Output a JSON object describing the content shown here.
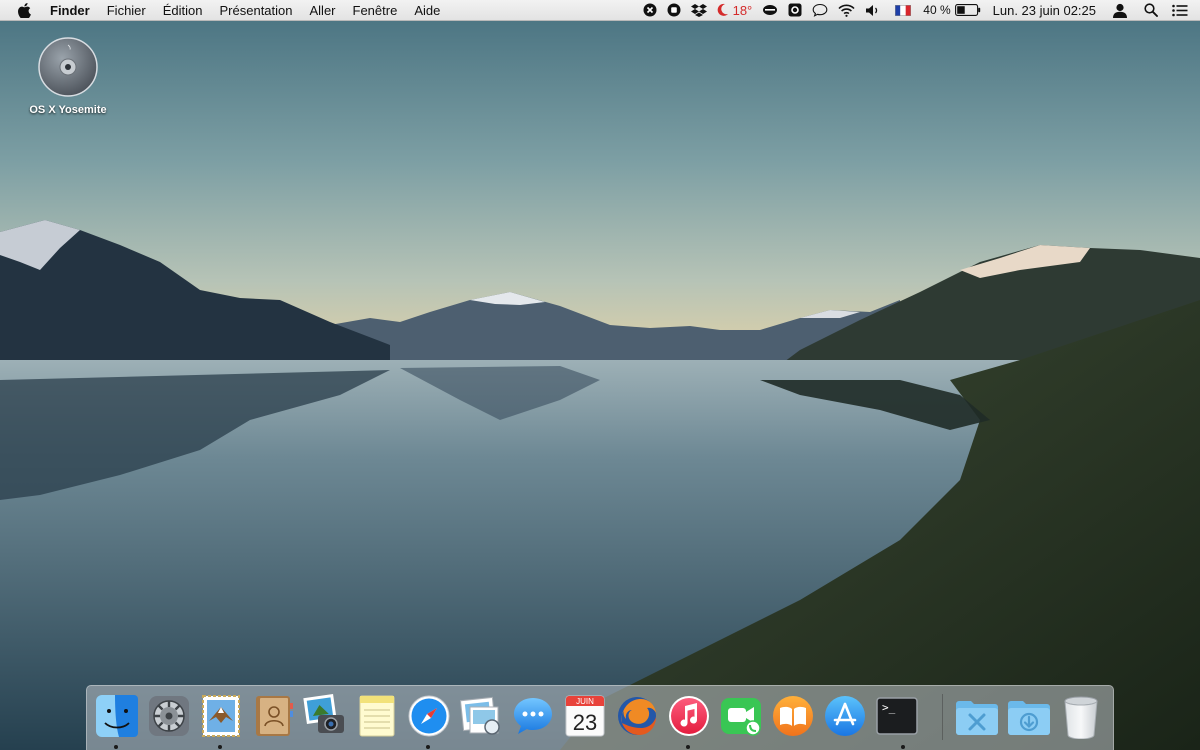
{
  "menubar": {
    "app_name": "Finder",
    "menus": [
      "Fichier",
      "Édition",
      "Présentation",
      "Aller",
      "Fenêtre",
      "Aide"
    ],
    "status": {
      "temperature": "18°",
      "battery_percent": "40 %",
      "clock": "Lun. 23 juin  02:25",
      "input_source": "fr-flag-icon",
      "battery_level": 0.4
    }
  },
  "desktop": {
    "disk_label": "OS X Yosemite"
  },
  "dock": {
    "apps": [
      {
        "name": "Finder",
        "icon": "finder-icon",
        "running": true
      },
      {
        "name": "System Preferences",
        "icon": "system-preferences-icon",
        "running": false
      },
      {
        "name": "Mail",
        "icon": "mail-icon",
        "running": true
      },
      {
        "name": "Contacts",
        "icon": "contacts-icon",
        "running": false
      },
      {
        "name": "iPhoto",
        "icon": "iphoto-icon",
        "running": false
      },
      {
        "name": "Notes",
        "icon": "notes-icon",
        "running": false
      },
      {
        "name": "Safari",
        "icon": "safari-icon",
        "running": true
      },
      {
        "name": "Preview",
        "icon": "preview-icon",
        "running": false
      },
      {
        "name": "Messages",
        "icon": "messages-icon",
        "running": false
      },
      {
        "name": "Calendar",
        "icon": "calendar-icon",
        "running": false
      },
      {
        "name": "Firefox",
        "icon": "firefox-icon",
        "running": false
      },
      {
        "name": "iTunes",
        "icon": "itunes-icon",
        "running": true
      },
      {
        "name": "FaceTime",
        "icon": "facetime-icon",
        "running": false
      },
      {
        "name": "iBooks",
        "icon": "ibooks-icon",
        "running": false
      },
      {
        "name": "App Store",
        "icon": "app-store-icon",
        "running": false
      },
      {
        "name": "Terminal",
        "icon": "terminal-icon",
        "running": true
      }
    ],
    "calendar_month": "JUIN",
    "calendar_day": "23",
    "terminal_prompt": ">_",
    "folders": [
      {
        "name": "Applications",
        "icon": "applications-folder-icon"
      },
      {
        "name": "Downloads",
        "icon": "downloads-folder-icon"
      },
      {
        "name": "Trash",
        "icon": "trash-icon"
      }
    ]
  }
}
